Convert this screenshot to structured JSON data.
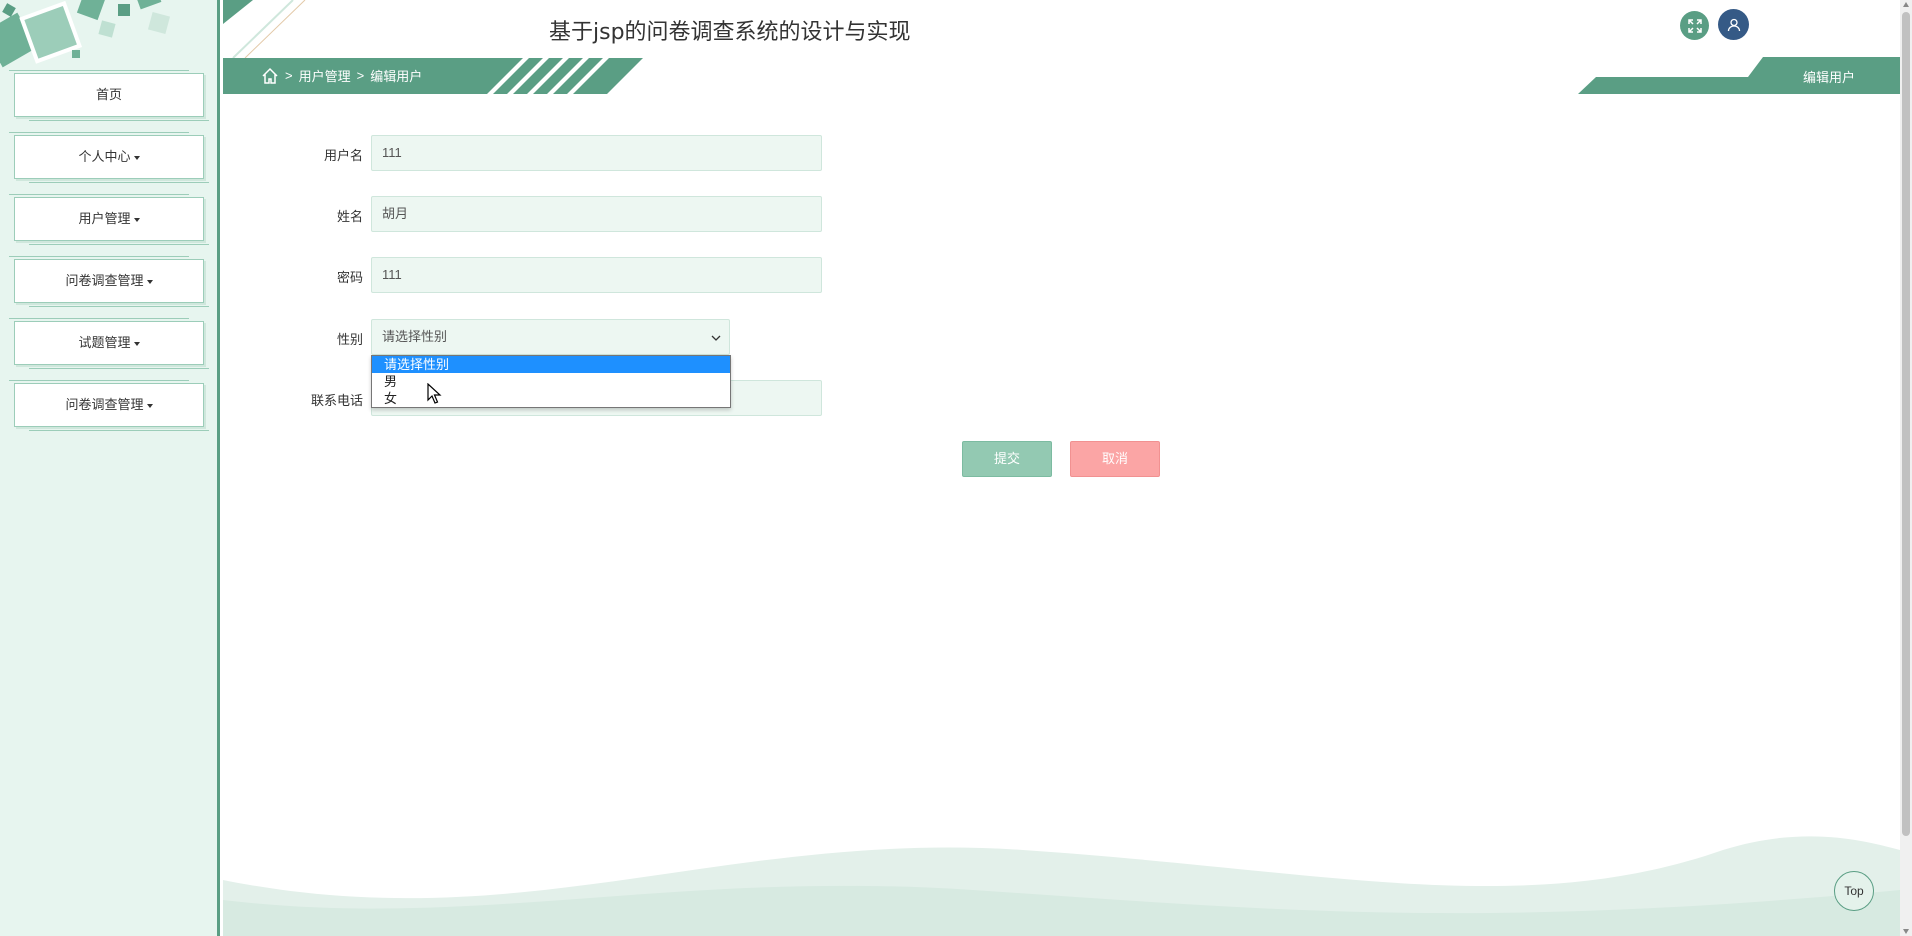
{
  "app": {
    "title": "基于jsp的问卷调查系统的设计与实现"
  },
  "sidebar": {
    "items": [
      {
        "label": "首页",
        "has_caret": false
      },
      {
        "label": "个人中心",
        "has_caret": true
      },
      {
        "label": "用户管理",
        "has_caret": true
      },
      {
        "label": "问卷调查管理",
        "has_caret": true
      },
      {
        "label": "试题管理",
        "has_caret": true
      },
      {
        "label": "问卷调查管理",
        "has_caret": true
      }
    ]
  },
  "breadcrumb": {
    "sep1": ">",
    "level1": "用户管理",
    "sep2": ">",
    "level2": "编辑用户"
  },
  "page_tab": "编辑用户",
  "form": {
    "username_label": "用户名",
    "username_value": "111",
    "name_label": "姓名",
    "name_value": "胡月",
    "password_label": "密码",
    "password_value": "111",
    "gender_label": "性别",
    "gender_value": "请选择性别",
    "phone_label": "联系电话",
    "phone_value": ""
  },
  "gender_dropdown": {
    "options": [
      "请选择性别",
      "男",
      "女"
    ],
    "highlighted_index": 0
  },
  "buttons": {
    "submit": "提交",
    "cancel": "取消",
    "top": "Top"
  },
  "colors": {
    "primary": "#5a9e84",
    "sidebar_bg": "#e7f5ef",
    "submit": "#93c9b2",
    "cancel": "#fba5a5",
    "user_button": "#355a86",
    "dropdown_highlight": "#1e90ff"
  },
  "icons": {
    "fullscreen": "expand-icon",
    "user": "user-icon",
    "home": "home-icon",
    "select_arrow": "chevron-down-icon",
    "cursor": "mouse-pointer-icon"
  }
}
